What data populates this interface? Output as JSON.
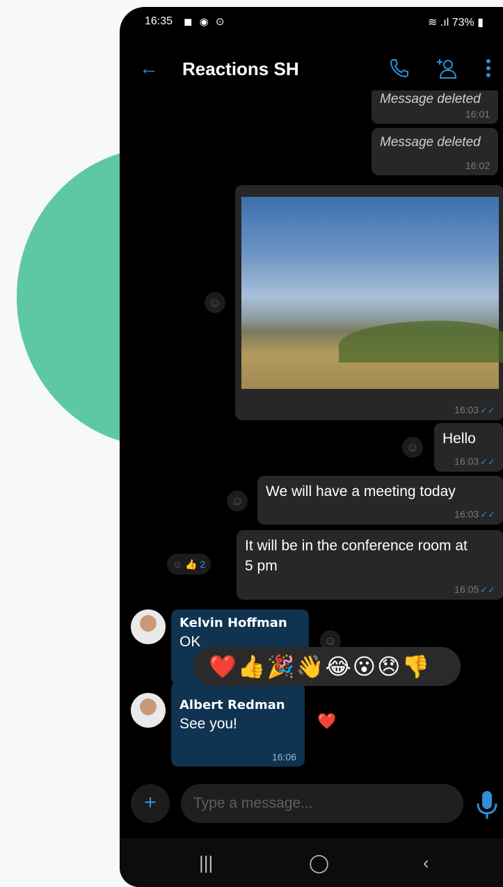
{
  "status_bar": {
    "time": "16:35",
    "notif_icons": "◼ ◉ ⊙",
    "battery": "73%"
  },
  "header": {
    "title": "Reactions SH"
  },
  "messages": {
    "deleted1": {
      "text": "Message deleted",
      "time": "16:01"
    },
    "deleted2": {
      "text": "Message deleted",
      "time": "16:02"
    },
    "photo": {
      "time": "16:03"
    },
    "hello": {
      "text": "Hello",
      "time": "16:03"
    },
    "meeting": {
      "text": "We will have a meeting today",
      "time": "16:03"
    },
    "conference": {
      "text": "It will be in the conference room at 5 pm",
      "time": "16:05",
      "reaction_count": "2"
    },
    "kelvin": {
      "sender": "Kelvin Hoffman",
      "text": "OK"
    },
    "albert": {
      "sender": "Albert Redman",
      "text": "See you!",
      "time": "16:06"
    }
  },
  "reaction_picker": {
    "emojis": [
      "❤️",
      "👍",
      "🎉",
      "👋",
      "😂",
      "😮",
      "😞",
      "👎"
    ]
  },
  "composer": {
    "placeholder": "Type a message..."
  },
  "colors": {
    "accent": "#2f8fd8",
    "incoming_bubble": "#0f3350",
    "outgoing_bubble": "#272727",
    "blob": "#5ec7a5"
  }
}
